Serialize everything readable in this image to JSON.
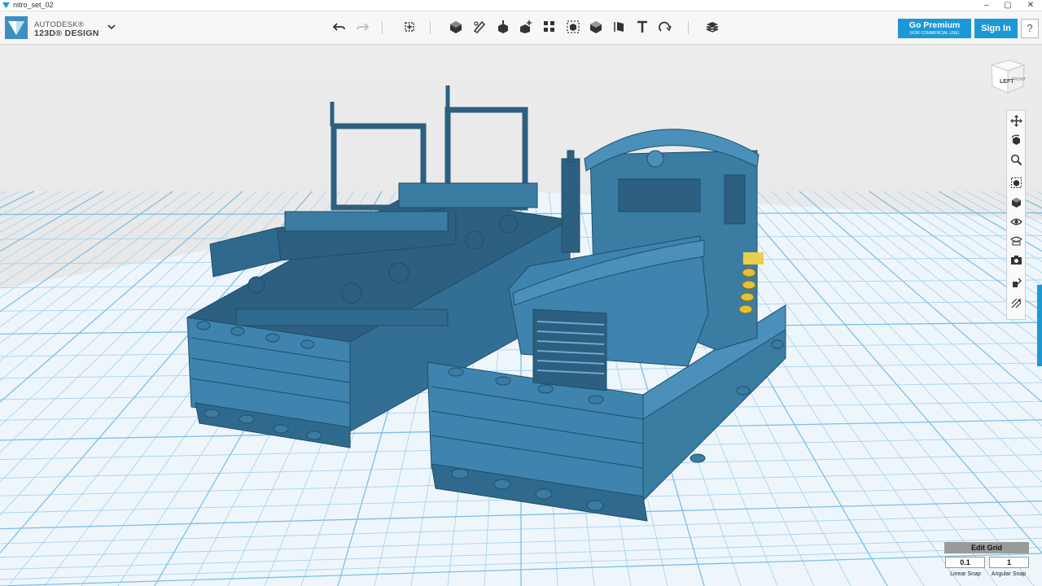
{
  "window": {
    "title": "nitro_set_02",
    "minimize_label": "–",
    "maximize_label": "▢",
    "close_label": "✕"
  },
  "brand": {
    "line1": "AUTODESK®",
    "line2": "123D® DESIGN"
  },
  "toolbar": {
    "tools": [
      "undo-icon",
      "redo-icon",
      "transform-icon",
      "primitives-icon",
      "sketch-icon",
      "construct-icon",
      "modify-icon",
      "pattern-icon",
      "grouping-icon",
      "combine-icon",
      "measure-icon",
      "text-icon",
      "snap-icon",
      "material-icon"
    ]
  },
  "account": {
    "premium_label": "Go Premium",
    "premium_sub": "(FOR COMMERCIAL USE)",
    "signin_label": "Sign In",
    "help_label": "?"
  },
  "viewcube": {
    "face_left": "LEFT",
    "face_front": "FRONT"
  },
  "nav_tools": [
    "pan-icon",
    "orbit-icon",
    "zoom-icon",
    "fit-icon",
    "perspective-icon",
    "visibility-icon",
    "materials-outline-icon",
    "screenshot-icon",
    "snap-settings-icon",
    "grid-settings-icon"
  ],
  "grid": {
    "header": "Edit Grid",
    "linear_value": "0.1",
    "angular_value": "1",
    "linear_label": "Linear Snap",
    "angular_label": "Angular Snap"
  },
  "colors": {
    "accent": "#1d98d6",
    "model": "#3b7ca3",
    "model_dark": "#2c5f80",
    "grid_line": "#a8d3ee",
    "background": "#e6e6e6"
  }
}
